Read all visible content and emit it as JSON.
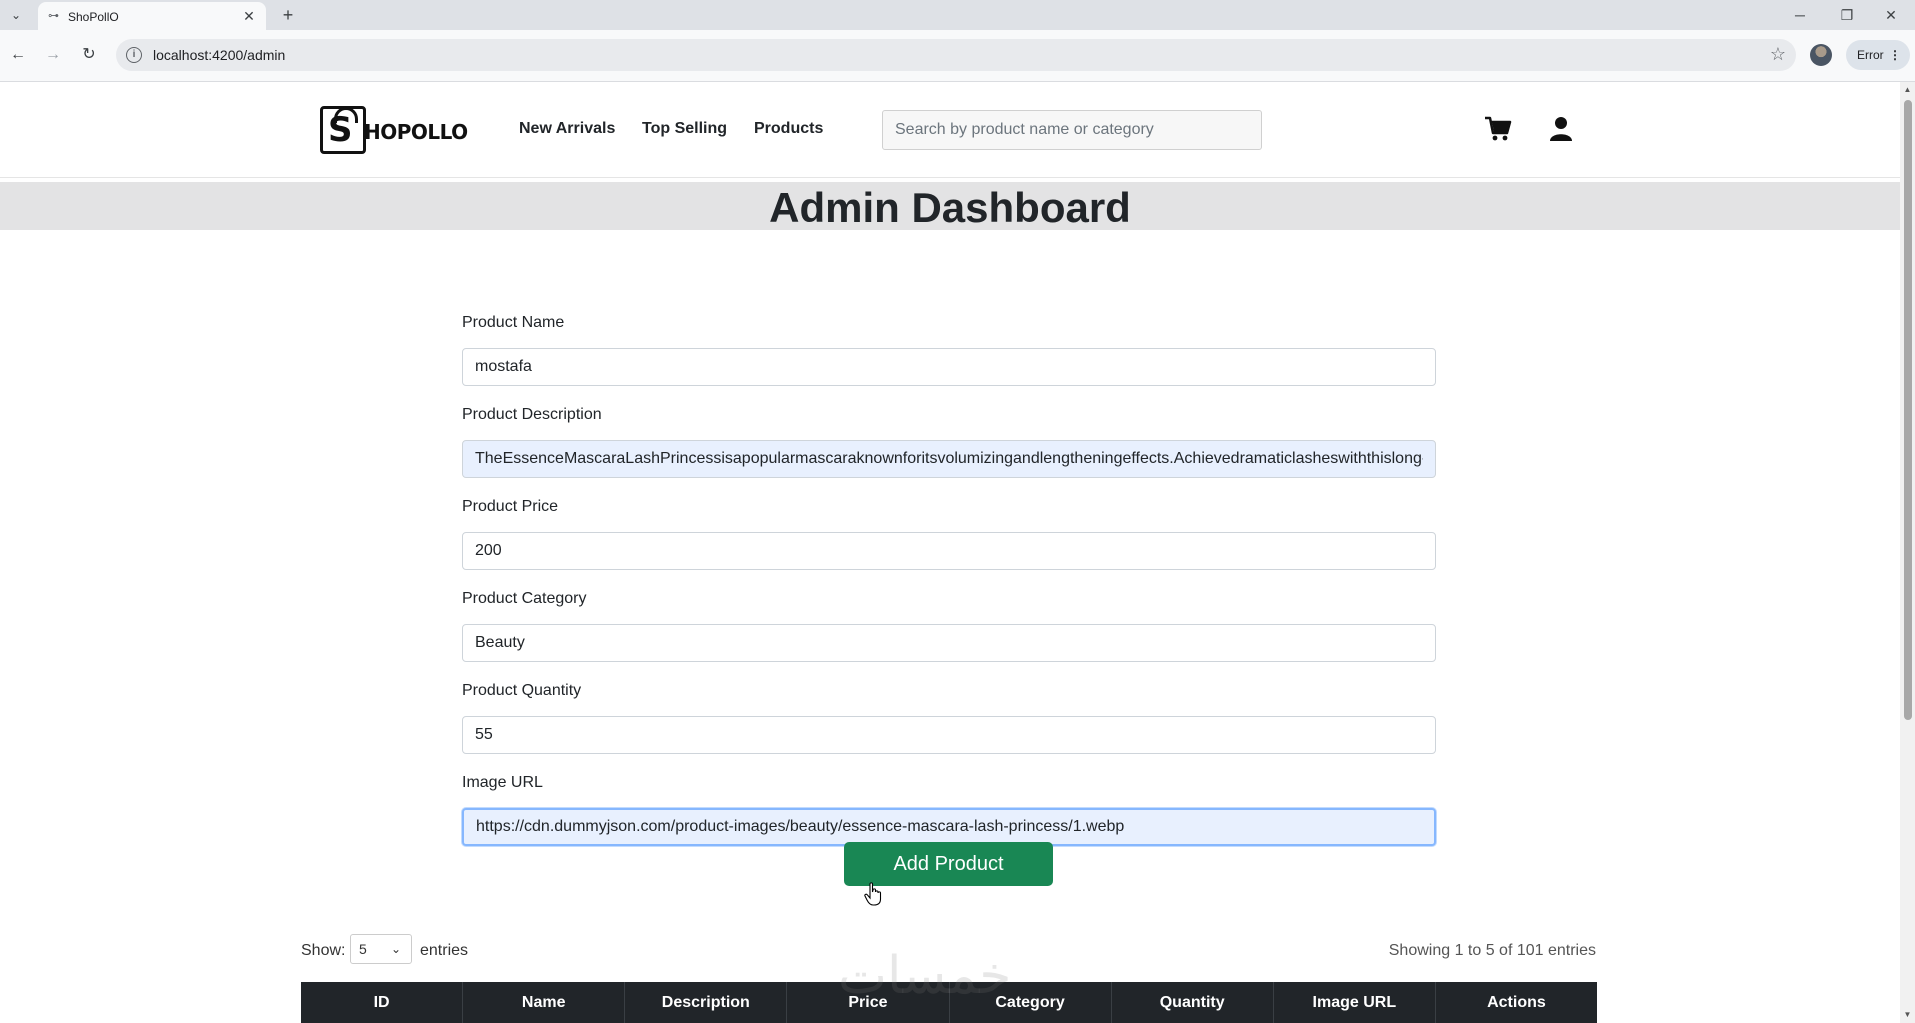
{
  "browser": {
    "tab_title": "ShoPollO",
    "url": "localhost:4200/admin",
    "error_label": "Error"
  },
  "navbar": {
    "logo_letter": "S",
    "logo_rest": "HOPOLLO",
    "links": [
      "New Arrivals",
      "Top Selling",
      "Products"
    ],
    "search_placeholder": "Search by product name or category"
  },
  "banner": {
    "title": "Admin Dashboard"
  },
  "form": {
    "fields": [
      {
        "label": "Product Name",
        "value": "mostafa"
      },
      {
        "label": "Product Description",
        "value": "TheEssenceMascaraLashPrincessisapopularmascaraknownforitsvolumizingandlengtheningeffects.Achievedramaticlasheswiththislong-la"
      },
      {
        "label": "Product Price",
        "value": "200"
      },
      {
        "label": "Product Category",
        "value": "Beauty"
      },
      {
        "label": "Product Quantity",
        "value": "55"
      },
      {
        "label": "Image URL",
        "value": "https://cdn.dummyjson.com/product-images/beauty/essence-mascara-lash-princess/1.webp"
      }
    ],
    "submit_label": "Add Product"
  },
  "table_controls": {
    "show_label": "Show:",
    "entries_value": "5",
    "entries_label": "entries",
    "info": "Showing 1 to 5 of 101 entries"
  },
  "table": {
    "headers": [
      "ID",
      "Name",
      "Description",
      "Price",
      "Category",
      "Quantity",
      "Image URL",
      "Actions"
    ]
  },
  "watermark": "خمسات",
  "colors": {
    "accent_green": "#198754",
    "table_header": "#212529",
    "banner_bg": "#e3e3e4"
  }
}
